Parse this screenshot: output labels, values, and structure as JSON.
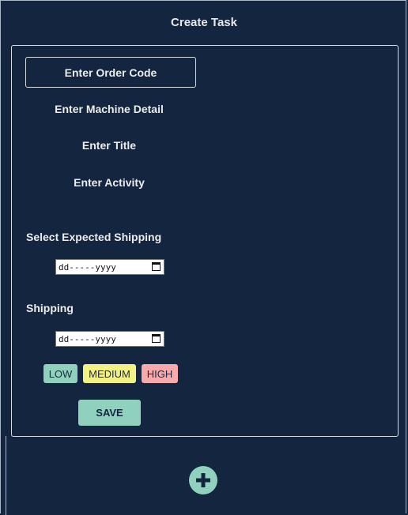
{
  "header": {
    "title": "Create Task"
  },
  "form": {
    "order_code_placeholder": "Enter Order Code",
    "machine_detail_placeholder": "Enter Machine Detail",
    "title_placeholder": "Enter Title",
    "activity_placeholder": "Enter Activity",
    "expected_shipping_label": "Select Expected Shipping",
    "expected_shipping_value": "dd-----yyyy",
    "shipping_label": "Shipping",
    "shipping_value": "dd-----yyyy"
  },
  "priority": {
    "low": {
      "label": "LOW",
      "color": "#8fd1bd"
    },
    "medium": {
      "label": "MEDIUM",
      "color": "#f3f184"
    },
    "high": {
      "label": "HIGH",
      "color": "#f6aaab"
    }
  },
  "actions": {
    "save_label": "SAVE",
    "add_icon": "plus-icon"
  },
  "colors": {
    "background": "#14263f",
    "accent": "#8fd1bd"
  }
}
